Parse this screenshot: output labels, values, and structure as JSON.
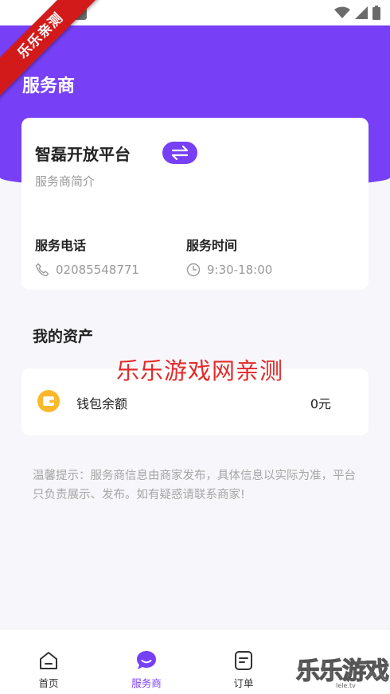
{
  "ribbon": {
    "text": "乐乐亲测"
  },
  "header": {
    "title": "服务商"
  },
  "platform": {
    "name": "智磊开放平台",
    "description": "服务商简介",
    "switch_icon": "swap-arrows-icon"
  },
  "contact": {
    "phone_label": "服务电话",
    "phone_value": "02085548771",
    "hours_label": "服务时间",
    "hours_value": "9:30-18:00"
  },
  "assets": {
    "title": "我的资产",
    "wallet_label": "钱包余额",
    "wallet_value": "0元"
  },
  "watermark": {
    "center_text": "乐乐游戏网亲测",
    "corner_text": "乐乐游戏",
    "corner_sub": "Iele.tv"
  },
  "notice": {
    "text": "温馨提示：服务商信息由商家发布，具体信息以实际为准，平台只负责展示、发布。如有疑惑请联系商家!"
  },
  "tabbar": {
    "items": [
      {
        "label": "首页",
        "icon": "home-icon",
        "active": false
      },
      {
        "label": "服务商",
        "icon": "chat-bubble-icon",
        "active": true
      },
      {
        "label": "订单",
        "icon": "order-icon",
        "active": false
      }
    ]
  },
  "colors": {
    "accent": "#7740f6",
    "wallet": "#fbb82b",
    "watermark": "#e32a2a",
    "ribbon": "#d21a1a"
  }
}
